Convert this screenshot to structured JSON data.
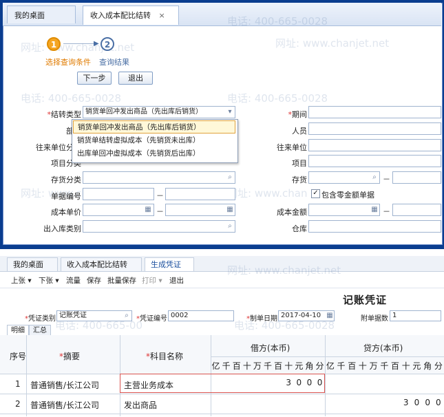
{
  "top_window": {
    "tabs": [
      {
        "label": "我的桌面"
      },
      {
        "label": "收入成本配比结转",
        "close": "×"
      }
    ],
    "steps": [
      {
        "number": "1",
        "label": "选择查询条件"
      },
      {
        "number": "2",
        "label": "查询结果"
      }
    ],
    "buttons": {
      "next": "下一步",
      "exit": "退出"
    },
    "form": {
      "transfer_type": {
        "label": "结转类型",
        "value": "销货单回冲发出商品（先出库后销货）"
      },
      "period": {
        "label": "期间"
      },
      "department": {
        "label": "部门"
      },
      "staff": {
        "label": "人员"
      },
      "partner_category": {
        "label": "往来单位分类"
      },
      "partner": {
        "label": "往来单位"
      },
      "project_category": {
        "label": "项目分类"
      },
      "project": {
        "label": "项目"
      },
      "stock_category": {
        "label": "存货分类"
      },
      "stock": {
        "label": "存货"
      },
      "doc_number": {
        "label": "单据编号"
      },
      "include_zero": {
        "label": "包含零金额单据",
        "checked": true
      },
      "unit_cost": {
        "label": "成本单价"
      },
      "cost_amount": {
        "label": "成本金额"
      },
      "io_category": {
        "label": "出入库类别"
      },
      "warehouse": {
        "label": "仓库"
      },
      "dash": "－"
    },
    "dropdown_options": [
      {
        "label": "销货单回冲发出商品（先出库后销货）",
        "selected": true
      },
      {
        "label": "销货单结转虚拟成本（先销货未出库）",
        "selected": false
      },
      {
        "label": "出库单回冲虚拟成本（先销货后出库）",
        "selected": false
      }
    ],
    "icons": {
      "step_arrow": "arrow-right-icon",
      "dropdown": "chevron-down-icon",
      "lookup": "search-icon",
      "calculator": "calculator-icon"
    }
  },
  "watermarks": {
    "phone": "电话: 400-665-0028",
    "url": "网址: www.chanjet.net",
    "url_partial_1": "网址: www.chanjet.ne",
    "url_partial_2": "网址: www.chan",
    "phone_partial": "电话: 400-665-00"
  },
  "bottom_window": {
    "tabs": [
      {
        "label": "我的桌面"
      },
      {
        "label": "收入成本配比结转",
        "close": "×"
      },
      {
        "label": "生成凭证",
        "close": "×"
      }
    ],
    "toolbar": [
      "上张 ▾",
      "下张 ▾",
      "流量",
      "保存",
      "批量保存",
      "打印 ▾",
      "退出"
    ],
    "voucher_title": "记账凭证",
    "header_fields": {
      "voucher_type": {
        "label": "凭证类别",
        "value": "记账凭证"
      },
      "voucher_number": {
        "label": "凭证编号",
        "value": "0002"
      },
      "made_date": {
        "label": "制单日期",
        "value": "2017-04-10"
      },
      "attachments": {
        "label": "附单据数",
        "value": "1"
      }
    },
    "sub_tabs": [
      "明细",
      "汇总"
    ],
    "columns": {
      "seq": "序号",
      "summary": "摘要",
      "account": "科目名称",
      "debit": "借方(本币)",
      "credit": "贷方(本币)",
      "digits": [
        "亿",
        "千",
        "百",
        "十",
        "万",
        "千",
        "百",
        "十",
        "元",
        "角",
        "分"
      ]
    },
    "rows": [
      {
        "seq": "1",
        "summary": "普通销售/长江公司",
        "account": "主营业务成本",
        "debit": [
          "3",
          "0",
          "0",
          "0"
        ],
        "credit": []
      },
      {
        "seq": "2",
        "summary": "普通销售/长江公司",
        "account": "发出商品",
        "debit": [],
        "credit": [
          "3",
          "0",
          "0",
          "0"
        ]
      }
    ]
  }
}
